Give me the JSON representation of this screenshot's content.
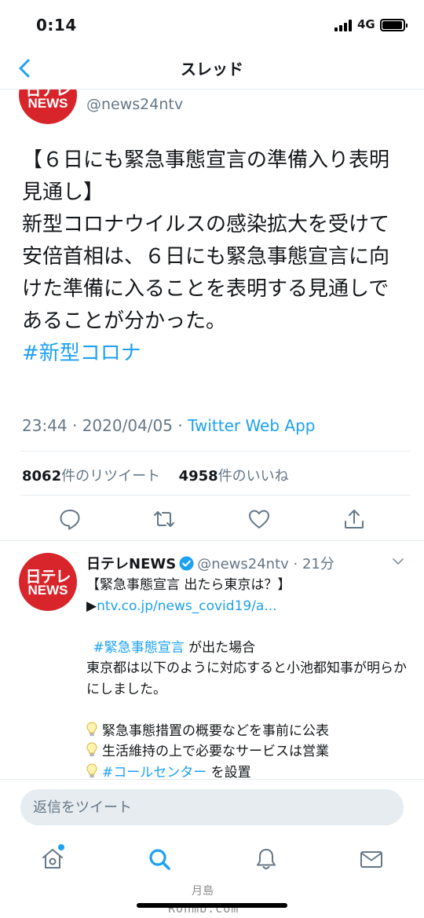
{
  "status_bar": {
    "time": "0:14",
    "network": "4G",
    "battery_level": 0.95
  },
  "nav": {
    "title": "スレッド"
  },
  "main_tweet": {
    "handle": "@news24ntv",
    "avatar_top": "日テレ",
    "avatar_bottom": "NEWS",
    "lines": [
      "【６日にも緊急事態宣言の準備入り表明見通し】",
      "新型コロナウイルスの感染拡大を受けて安倍首相は、６日にも緊急事態宣言に向けた準備に入ることを表明する見通しであることが分かった。"
    ],
    "hashtag": "#新型コロナ",
    "time": "23:44 · 2020/04/05 · ",
    "source": "Twitter Web App",
    "retweet_count": "8062",
    "retweet_label": "件のリツイート",
    "like_count": "4958",
    "like_label": "件のいいね"
  },
  "reply_tweet": {
    "name": "日テレNEWS",
    "handle_time": "@news24ntv · 21分",
    "avatar_top": "日テレ",
    "avatar_bottom": "NEWS",
    "line1": "【緊急事態宣言 出たら東京は？】",
    "link_prefix": "▶",
    "link": "ntv.co.jp/news_covid19/a...",
    "hashtag1": "#緊急事態宣言",
    "after_hashtag1": " が出た場合",
    "body": "東京都は以下のように対応すると小池都知事が明らかにしました。",
    "bullet1": "緊急事態措置の概要などを事前に公表",
    "bullet2": "生活維持の上で必要なサービスは営業",
    "bullet3_hashtag": "#コールセンター",
    "bullet3_rest": " を設置"
  },
  "reply_compose": {
    "placeholder": "返信をツイート"
  },
  "tab_bar": [
    "home-icon",
    "search-icon",
    "notifications-icon",
    "messages-icon"
  ],
  "watermark": {
    "top": "月島",
    "bottom": "ROnmb.com"
  },
  "colors": {
    "accent": "#1da1f2",
    "muted": "#657786",
    "brand_red": "#d8252b"
  }
}
